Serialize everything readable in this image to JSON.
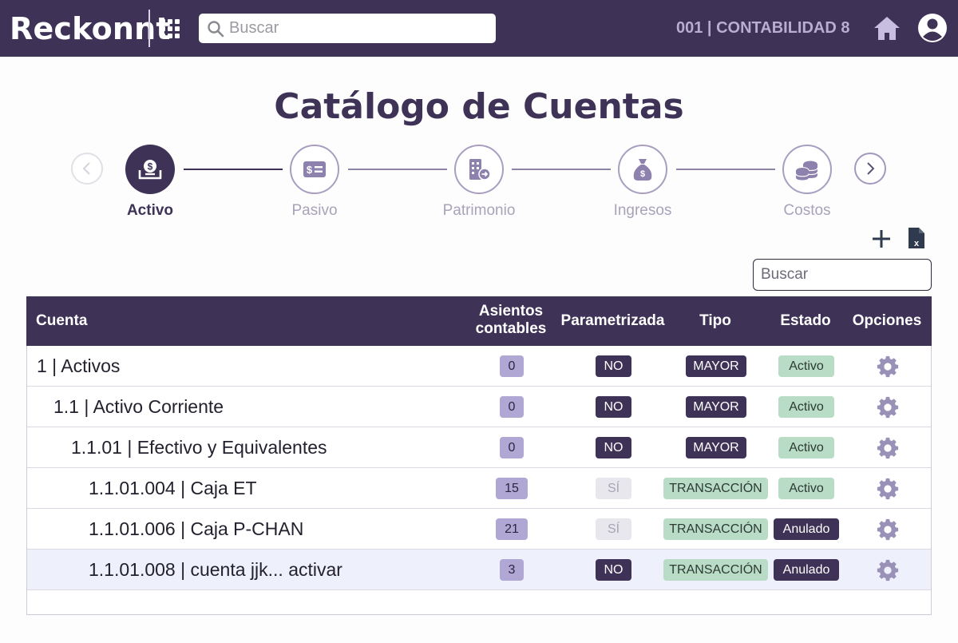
{
  "header": {
    "logo": "Reckonnt",
    "search_placeholder": "Buscar",
    "company": "001 | CONTABILIDAD 8"
  },
  "page": {
    "title": "Catálogo de Cuentas"
  },
  "steps": [
    {
      "label": "Activo",
      "icon": "money-box-icon",
      "active": true
    },
    {
      "label": "Pasivo",
      "icon": "bill-icon",
      "active": false
    },
    {
      "label": "Patrimonio",
      "icon": "building-icon",
      "active": false
    },
    {
      "label": "Ingresos",
      "icon": "money-bag-icon",
      "active": false
    },
    {
      "label": "Costos",
      "icon": "coins-icon",
      "active": false
    }
  ],
  "tools": {
    "search_placeholder": "Buscar"
  },
  "table": {
    "headers": {
      "cuenta": "Cuenta",
      "asientos_1": "Asientos",
      "asientos_2": "contables",
      "parametrizada": "Parametrizada",
      "tipo": "Tipo",
      "estado": "Estado",
      "opciones": "Opciones"
    },
    "rows": [
      {
        "cuenta": "1 | Activos",
        "asientos": "0",
        "parametrizada": "NO",
        "tipo": "MAYOR",
        "estado": "Activo"
      },
      {
        "cuenta": "1.1 | Activo Corriente",
        "asientos": "0",
        "parametrizada": "NO",
        "tipo": "MAYOR",
        "estado": "Activo"
      },
      {
        "cuenta": "1.1.01 | Efectivo y Equivalentes",
        "asientos": "0",
        "parametrizada": "NO",
        "tipo": "MAYOR",
        "estado": "Activo"
      },
      {
        "cuenta": "1.1.01.004 | Caja ET",
        "asientos": "15",
        "parametrizada": "SÍ",
        "tipo": "TRANSACCIÓN",
        "estado": "Activo"
      },
      {
        "cuenta": "1.1.01.006 | Caja P-CHAN",
        "asientos": "21",
        "parametrizada": "SÍ",
        "tipo": "TRANSACCIÓN",
        "estado": "Anulado"
      },
      {
        "cuenta": "1.1.01.008 | cuenta jjk... activar",
        "asientos": "3",
        "parametrizada": "NO",
        "tipo": "TRANSACCIÓN",
        "estado": "Anulado"
      }
    ]
  }
}
